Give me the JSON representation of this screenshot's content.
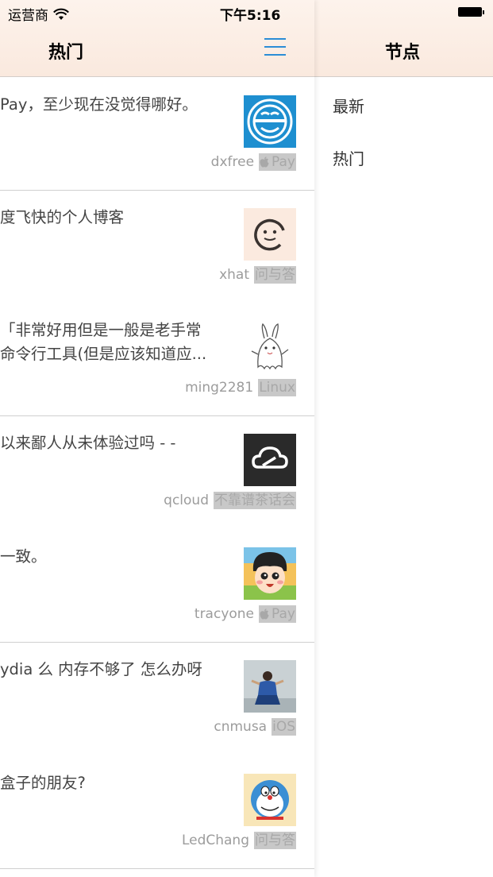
{
  "status": {
    "carrier": "运营商",
    "time": "下午5:16"
  },
  "main": {
    "title": "热门",
    "topics": [
      {
        "title_lines": [
          "Pay，至少现在没觉得哪好。"
        ],
        "user": "dxfree",
        "node": "Pay",
        "node_icon": "apple-icon"
      },
      {
        "title_lines": [
          "度飞快的个人博客"
        ],
        "user": "xhat",
        "node": "问与答"
      },
      {
        "title_lines": [
          "「非常好用但是一般是老手常",
          "命令行工具(但是应该知道应..."
        ],
        "user": "ming2281",
        "node": "Linux"
      },
      {
        "title_lines": [
          "以来鄙人从未体验过吗 - -"
        ],
        "user": "qcloud",
        "node": "不靠谱茶话会"
      },
      {
        "title_lines": [
          "一致。"
        ],
        "user": "tracyone",
        "node": "Pay",
        "node_icon": "apple-icon"
      },
      {
        "title_lines": [
          "ydia 么 内存不够了 怎么办呀"
        ],
        "user": "cnmusa",
        "node": "iOS"
      },
      {
        "title_lines": [
          "盒子的朋友?"
        ],
        "user": "LedChang",
        "node": "问与答"
      }
    ]
  },
  "side": {
    "title": "节点",
    "items": [
      "最新",
      "热门"
    ]
  },
  "colors": {
    "accent": "#2b8dd6",
    "nav_bg": "#fbeee5",
    "meta": "#9c9c9c",
    "tag_bg": "#c8c8c8"
  }
}
